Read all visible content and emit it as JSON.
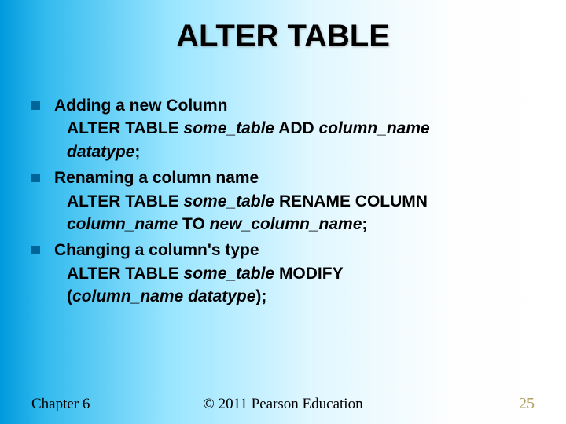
{
  "title": "ALTER TABLE",
  "items": [
    {
      "heading": "Adding a new Column",
      "line1_pre": "ALTER TABLE ",
      "line1_i1": "some_table",
      "line1_mid": " ADD ",
      "line1_i2": "column_name",
      "line2_i1": "datatype",
      "line2_post": ";"
    },
    {
      "heading": "Renaming a column name",
      "line1_pre": "ALTER TABLE ",
      "line1_i1": "some_table",
      "line1_mid": " RENAME COLUMN",
      "line2_i1": "column_name",
      "line2_mid": " TO ",
      "line2_i2": "new_column_name",
      "line2_post": ";"
    },
    {
      "heading": "Changing a column's type",
      "line1_pre": "ALTER TABLE ",
      "line1_i1": "some_table",
      "line1_mid": " MODIFY",
      "line2_pre": "(",
      "line2_i1": "column_name",
      "line2_mid": " ",
      "line2_i2": "datatype",
      "line2_post": ");"
    }
  ],
  "footer": {
    "left": "Chapter 6",
    "center": "© 2011 Pearson Education",
    "right": "25"
  }
}
